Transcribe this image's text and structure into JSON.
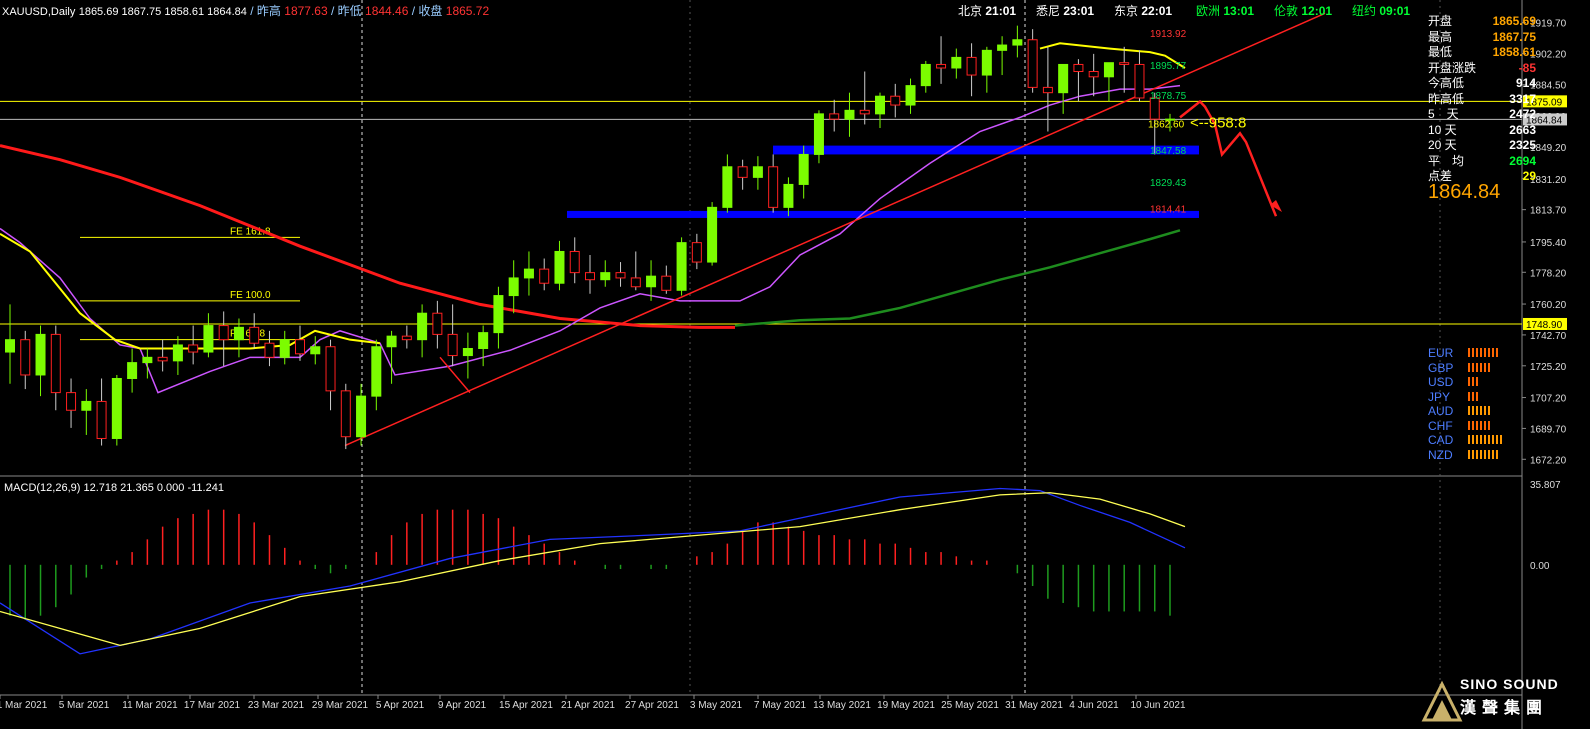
{
  "header": {
    "symbol": "XAUUSD,Daily",
    "ohlc": "1865.69 1867.75 1858.61 1864.84",
    "prev_high_label": "/ 昨高",
    "prev_high": "1877.63",
    "prev_low_label": "/ 昨低",
    "prev_low": "1844.46",
    "close_label": "/ 收盘",
    "close": "1865.72"
  },
  "clocks": [
    {
      "city": "北京",
      "time": "21:01",
      "city_color": "#ffffff",
      "time_color": "#ffffff"
    },
    {
      "city": "悉尼",
      "time": "23:01",
      "city_color": "#ffffff",
      "time_color": "#ffffff"
    },
    {
      "city": "东京",
      "time": "22:01",
      "city_color": "#ffffff",
      "time_color": "#ffffff"
    },
    {
      "city": "欧洲",
      "time": "13:01",
      "city_color": "#00ff33",
      "time_color": "#00ff33"
    },
    {
      "city": "伦敦",
      "time": "12:01",
      "city_color": "#00ff33",
      "time_color": "#00ff33"
    },
    {
      "city": "纽约",
      "time": "09:01",
      "city_color": "#00ff33",
      "time_color": "#00ff33"
    }
  ],
  "stats_panel": [
    {
      "label": "开盘",
      "value": "1865.69",
      "color": "#ffa500"
    },
    {
      "label": "最高",
      "value": "1867.75",
      "color": "#ffa500"
    },
    {
      "label": "最低",
      "value": "1858.61",
      "color": "#ffa500"
    },
    {
      "label": "开盘涨跌",
      "value": "-85",
      "color": "#ff3333"
    },
    {
      "label": "今高低",
      "value": "914",
      "color": "#ffffff"
    },
    {
      "label": "昨高低",
      "value": "3317",
      "color": "#ffffff"
    },
    {
      "label": "5　天",
      "value": "2472",
      "color": "#ffffff"
    },
    {
      "label": "10 天",
      "value": "2663",
      "color": "#ffffff"
    },
    {
      "label": "20 天",
      "value": "2325",
      "color": "#ffffff"
    },
    {
      "label": "平　均",
      "value": "2694",
      "color": "#00ff33"
    },
    {
      "label": "点差",
      "value": "29",
      "color": "#ffff00"
    }
  ],
  "current_price": "1864.84",
  "currencies": [
    {
      "name": "EUR",
      "bars": 8,
      "color": "#ff6600"
    },
    {
      "name": "GBP",
      "bars": 6,
      "color": "#ff6600"
    },
    {
      "name": "USD",
      "bars": 3,
      "color": "#ff6600"
    },
    {
      "name": "JPY",
      "bars": 3,
      "color": "#ff6600"
    },
    {
      "name": "AUD",
      "bars": 6,
      "color": "#ff9900"
    },
    {
      "name": "CHF",
      "bars": 6,
      "color": "#ff6600"
    },
    {
      "name": "CAD",
      "bars": 9,
      "color": "#ff9900"
    },
    {
      "name": "NZD",
      "bars": 8,
      "color": "#ff9900"
    }
  ],
  "macd_label": "MACD(12,26,9) 12.718 21.365 0.000 -11.241",
  "logo": {
    "name": "SINO SOUND",
    "sub": "漢聲集團"
  },
  "colors": {
    "bull": "#7cfc00",
    "bear": "#ff2020",
    "ma_long": "#ff1a1a",
    "ma_mid": "#1e8c1e",
    "ma_short": "#cc55ff",
    "ma_fast": "#ffff00",
    "trend": "#ff2020",
    "zone": "#0000ff"
  },
  "chart_data": {
    "type": "candlestick",
    "title": "",
    "ylim": [
      1665,
      1928
    ],
    "y_ticks": [
      "1919.70",
      "1902.20",
      "1884.50",
      "1866.90",
      "1849.20",
      "1831.20",
      "1813.70",
      "1795.40",
      "1778.20",
      "1760.20",
      "1742.70",
      "1725.20",
      "1707.20",
      "1689.70",
      "1672.20"
    ],
    "x_ticks": [
      "1 Mar 2021",
      "5 Mar 2021",
      "11 Mar 2021",
      "17 Mar 2021",
      "23 Mar 2021",
      "29 Mar 2021",
      "5 Apr 2021",
      "9 Apr 2021",
      "15 Apr 2021",
      "21 Apr 2021",
      "27 Apr 2021",
      "3 May 2021",
      "7 May 2021",
      "13 May 2021",
      "19 May 2021",
      "25 May 2021",
      "31 May 2021",
      "4 Jun 2021",
      "10 Jun 2021"
    ],
    "candles": [
      [
        1733,
        1760,
        1715,
        1740
      ],
      [
        1740,
        1745,
        1712,
        1720
      ],
      [
        1720,
        1748,
        1708,
        1743
      ],
      [
        1743,
        1748,
        1700,
        1710
      ],
      [
        1710,
        1718,
        1690,
        1700
      ],
      [
        1700,
        1712,
        1686,
        1705
      ],
      [
        1705,
        1718,
        1680,
        1684
      ],
      [
        1684,
        1720,
        1680,
        1718
      ],
      [
        1718,
        1735,
        1710,
        1727
      ],
      [
        1727,
        1735,
        1718,
        1730
      ],
      [
        1730,
        1740,
        1722,
        1728
      ],
      [
        1728,
        1742,
        1720,
        1737
      ],
      [
        1737,
        1748,
        1726,
        1733
      ],
      [
        1733,
        1755,
        1730,
        1748
      ],
      [
        1748,
        1756,
        1725,
        1740
      ],
      [
        1740,
        1752,
        1730,
        1747
      ],
      [
        1747,
        1755,
        1735,
        1738
      ],
      [
        1738,
        1745,
        1725,
        1730
      ],
      [
        1730,
        1745,
        1726,
        1740
      ],
      [
        1740,
        1748,
        1728,
        1732
      ],
      [
        1732,
        1742,
        1726,
        1736
      ],
      [
        1736,
        1740,
        1700,
        1711
      ],
      [
        1711,
        1715,
        1678,
        1685
      ],
      [
        1685,
        1715,
        1680,
        1708
      ],
      [
        1708,
        1740,
        1700,
        1736
      ],
      [
        1736,
        1745,
        1715,
        1742
      ],
      [
        1742,
        1748,
        1735,
        1740
      ],
      [
        1740,
        1760,
        1730,
        1755
      ],
      [
        1755,
        1762,
        1735,
        1743
      ],
      [
        1743,
        1760,
        1725,
        1731
      ],
      [
        1731,
        1744,
        1718,
        1735
      ],
      [
        1735,
        1748,
        1725,
        1744
      ],
      [
        1744,
        1770,
        1735,
        1765
      ],
      [
        1765,
        1785,
        1755,
        1775
      ],
      [
        1775,
        1790,
        1765,
        1780
      ],
      [
        1780,
        1786,
        1768,
        1772
      ],
      [
        1772,
        1796,
        1768,
        1790
      ],
      [
        1790,
        1798,
        1772,
        1778
      ],
      [
        1778,
        1788,
        1766,
        1774
      ],
      [
        1774,
        1785,
        1770,
        1778
      ],
      [
        1778,
        1784,
        1770,
        1775
      ],
      [
        1775,
        1790,
        1768,
        1770
      ],
      [
        1770,
        1785,
        1762,
        1776
      ],
      [
        1776,
        1782,
        1766,
        1768
      ],
      [
        1768,
        1798,
        1765,
        1795
      ],
      [
        1795,
        1800,
        1780,
        1784
      ],
      [
        1784,
        1818,
        1782,
        1815
      ],
      [
        1815,
        1845,
        1812,
        1838
      ],
      [
        1838,
        1842,
        1825,
        1832
      ],
      [
        1832,
        1844,
        1825,
        1838
      ],
      [
        1838,
        1845,
        1812,
        1815
      ],
      [
        1815,
        1832,
        1810,
        1828
      ],
      [
        1828,
        1850,
        1820,
        1845
      ],
      [
        1845,
        1870,
        1840,
        1868
      ],
      [
        1868,
        1876,
        1858,
        1865
      ],
      [
        1865,
        1880,
        1855,
        1870
      ],
      [
        1870,
        1892,
        1862,
        1868
      ],
      [
        1868,
        1880,
        1860,
        1878
      ],
      [
        1878,
        1885,
        1866,
        1873
      ],
      [
        1873,
        1888,
        1868,
        1884
      ],
      [
        1884,
        1898,
        1880,
        1896
      ],
      [
        1896,
        1912,
        1885,
        1894
      ],
      [
        1894,
        1905,
        1888,
        1900
      ],
      [
        1900,
        1908,
        1878,
        1890
      ],
      [
        1890,
        1906,
        1880,
        1904
      ],
      [
        1904,
        1912,
        1890,
        1907
      ],
      [
        1907,
        1918,
        1900,
        1910
      ],
      [
        1910,
        1916,
        1880,
        1883
      ],
      [
        1883,
        1906,
        1858,
        1880
      ],
      [
        1880,
        1892,
        1868,
        1896
      ],
      [
        1896,
        1899,
        1875,
        1892
      ],
      [
        1892,
        1902,
        1878,
        1889
      ],
      [
        1889,
        1897,
        1875,
        1897
      ],
      [
        1897,
        1906,
        1880,
        1896
      ],
      [
        1896,
        1904,
        1875,
        1877
      ],
      [
        1877,
        1880,
        1845,
        1865
      ],
      [
        1865,
        1868,
        1858,
        1865
      ]
    ],
    "lines": {
      "ma_long": [
        [
          0,
          1850
        ],
        [
          60,
          1842
        ],
        [
          120,
          1832
        ],
        [
          200,
          1816
        ],
        [
          300,
          1793
        ],
        [
          400,
          1772
        ],
        [
          480,
          1760
        ],
        [
          560,
          1752
        ],
        [
          640,
          1748
        ],
        [
          700,
          1747
        ],
        [
          735,
          1747
        ]
      ],
      "ma_mid": [
        [
          735,
          1748
        ],
        [
          800,
          1751
        ],
        [
          850,
          1752
        ],
        [
          900,
          1758
        ],
        [
          950,
          1766
        ],
        [
          1000,
          1774
        ],
        [
          1050,
          1781
        ],
        [
          1100,
          1789
        ],
        [
          1150,
          1797
        ],
        [
          1180,
          1802
        ]
      ],
      "ma_short": [
        [
          0,
          1803
        ],
        [
          20,
          1795
        ],
        [
          60,
          1775
        ],
        [
          90,
          1752
        ],
        [
          120,
          1737
        ],
        [
          140,
          1735
        ],
        [
          158,
          1710
        ],
        [
          210,
          1722
        ],
        [
          250,
          1730
        ],
        [
          300,
          1730
        ],
        [
          320,
          1740
        ],
        [
          340,
          1745
        ],
        [
          380,
          1738
        ],
        [
          395,
          1720
        ],
        [
          450,
          1725
        ],
        [
          510,
          1734
        ],
        [
          560,
          1745
        ],
        [
          600,
          1758
        ],
        [
          640,
          1766
        ],
        [
          680,
          1762
        ],
        [
          740,
          1762
        ],
        [
          770,
          1770
        ],
        [
          800,
          1788
        ],
        [
          840,
          1800
        ],
        [
          880,
          1820
        ],
        [
          930,
          1840
        ],
        [
          980,
          1858
        ],
        [
          1020,
          1866
        ],
        [
          1050,
          1873
        ],
        [
          1080,
          1878
        ],
        [
          1120,
          1882
        ],
        [
          1150,
          1882
        ],
        [
          1180,
          1884
        ]
      ],
      "ma_fast": [
        [
          0,
          1800
        ],
        [
          30,
          1790
        ],
        [
          80,
          1755
        ],
        [
          115,
          1740
        ],
        [
          140,
          1735
        ],
        [
          160,
          1735
        ],
        [
          200,
          1735
        ],
        [
          250,
          1735
        ],
        [
          290,
          1737
        ],
        [
          315,
          1745
        ],
        [
          350,
          1740
        ],
        [
          380,
          1738
        ]
      ],
      "ma_fast2": [
        [
          1040,
          1905
        ],
        [
          1060,
          1908
        ],
        [
          1110,
          1905
        ],
        [
          1150,
          1903
        ],
        [
          1165,
          1901
        ],
        [
          1185,
          1894
        ]
      ],
      "trend1": [
        [
          345,
          1680
        ],
        [
          1325,
          1925
        ]
      ],
      "trend_seg": [
        [
          440,
          1730
        ],
        [
          470,
          1710
        ]
      ],
      "forecast": [
        [
          1180,
          1866
        ],
        [
          1200,
          1875
        ],
        [
          1205,
          1872
        ],
        [
          1215,
          1862
        ],
        [
          1222,
          1845
        ],
        [
          1240,
          1857
        ],
        [
          1246,
          1852
        ],
        [
          1276,
          1810
        ]
      ]
    },
    "levels": [
      {
        "price": 1875.09,
        "color": "#ffff00",
        "label": "1875.09"
      },
      {
        "price": 1864.84,
        "color": "#bbbbbb",
        "label": "1864.84"
      },
      {
        "price": 1748.9,
        "color": "#ffff00",
        "label": "1748.90"
      }
    ],
    "fib_labels": [
      "FE 161.8",
      "FE 100.0",
      "FE 61.8"
    ],
    "zones": [
      {
        "from": 1845,
        "to": 1850
      },
      {
        "from": 1809,
        "to": 1813
      }
    ],
    "annotations": [
      {
        "text": "1913.92",
        "color": "#ff3333",
        "price": 1913.92
      },
      {
        "text": "1895.77",
        "color": "#00dd55",
        "price": 1895.77
      },
      {
        "text": "1878.75",
        "color": "#00dd55",
        "price": 1878.75
      },
      {
        "text": "1862.60",
        "color": "#ffff00",
        "price": 1862.6
      },
      {
        "text": "<--958:8",
        "color": "#ffff00",
        "price": 1862.6
      },
      {
        "text": "1847.58",
        "color": "#00dd55",
        "price": 1847.58
      },
      {
        "text": "1829.43",
        "color": "#00dd55",
        "price": 1829.43
      },
      {
        "text": "1814.41",
        "color": "#ff3333",
        "price": 1814.41
      }
    ],
    "macd": {
      "ylim": [
        -60,
        40
      ],
      "top_label": "35.807",
      "zero_label": "0.00"
    }
  }
}
